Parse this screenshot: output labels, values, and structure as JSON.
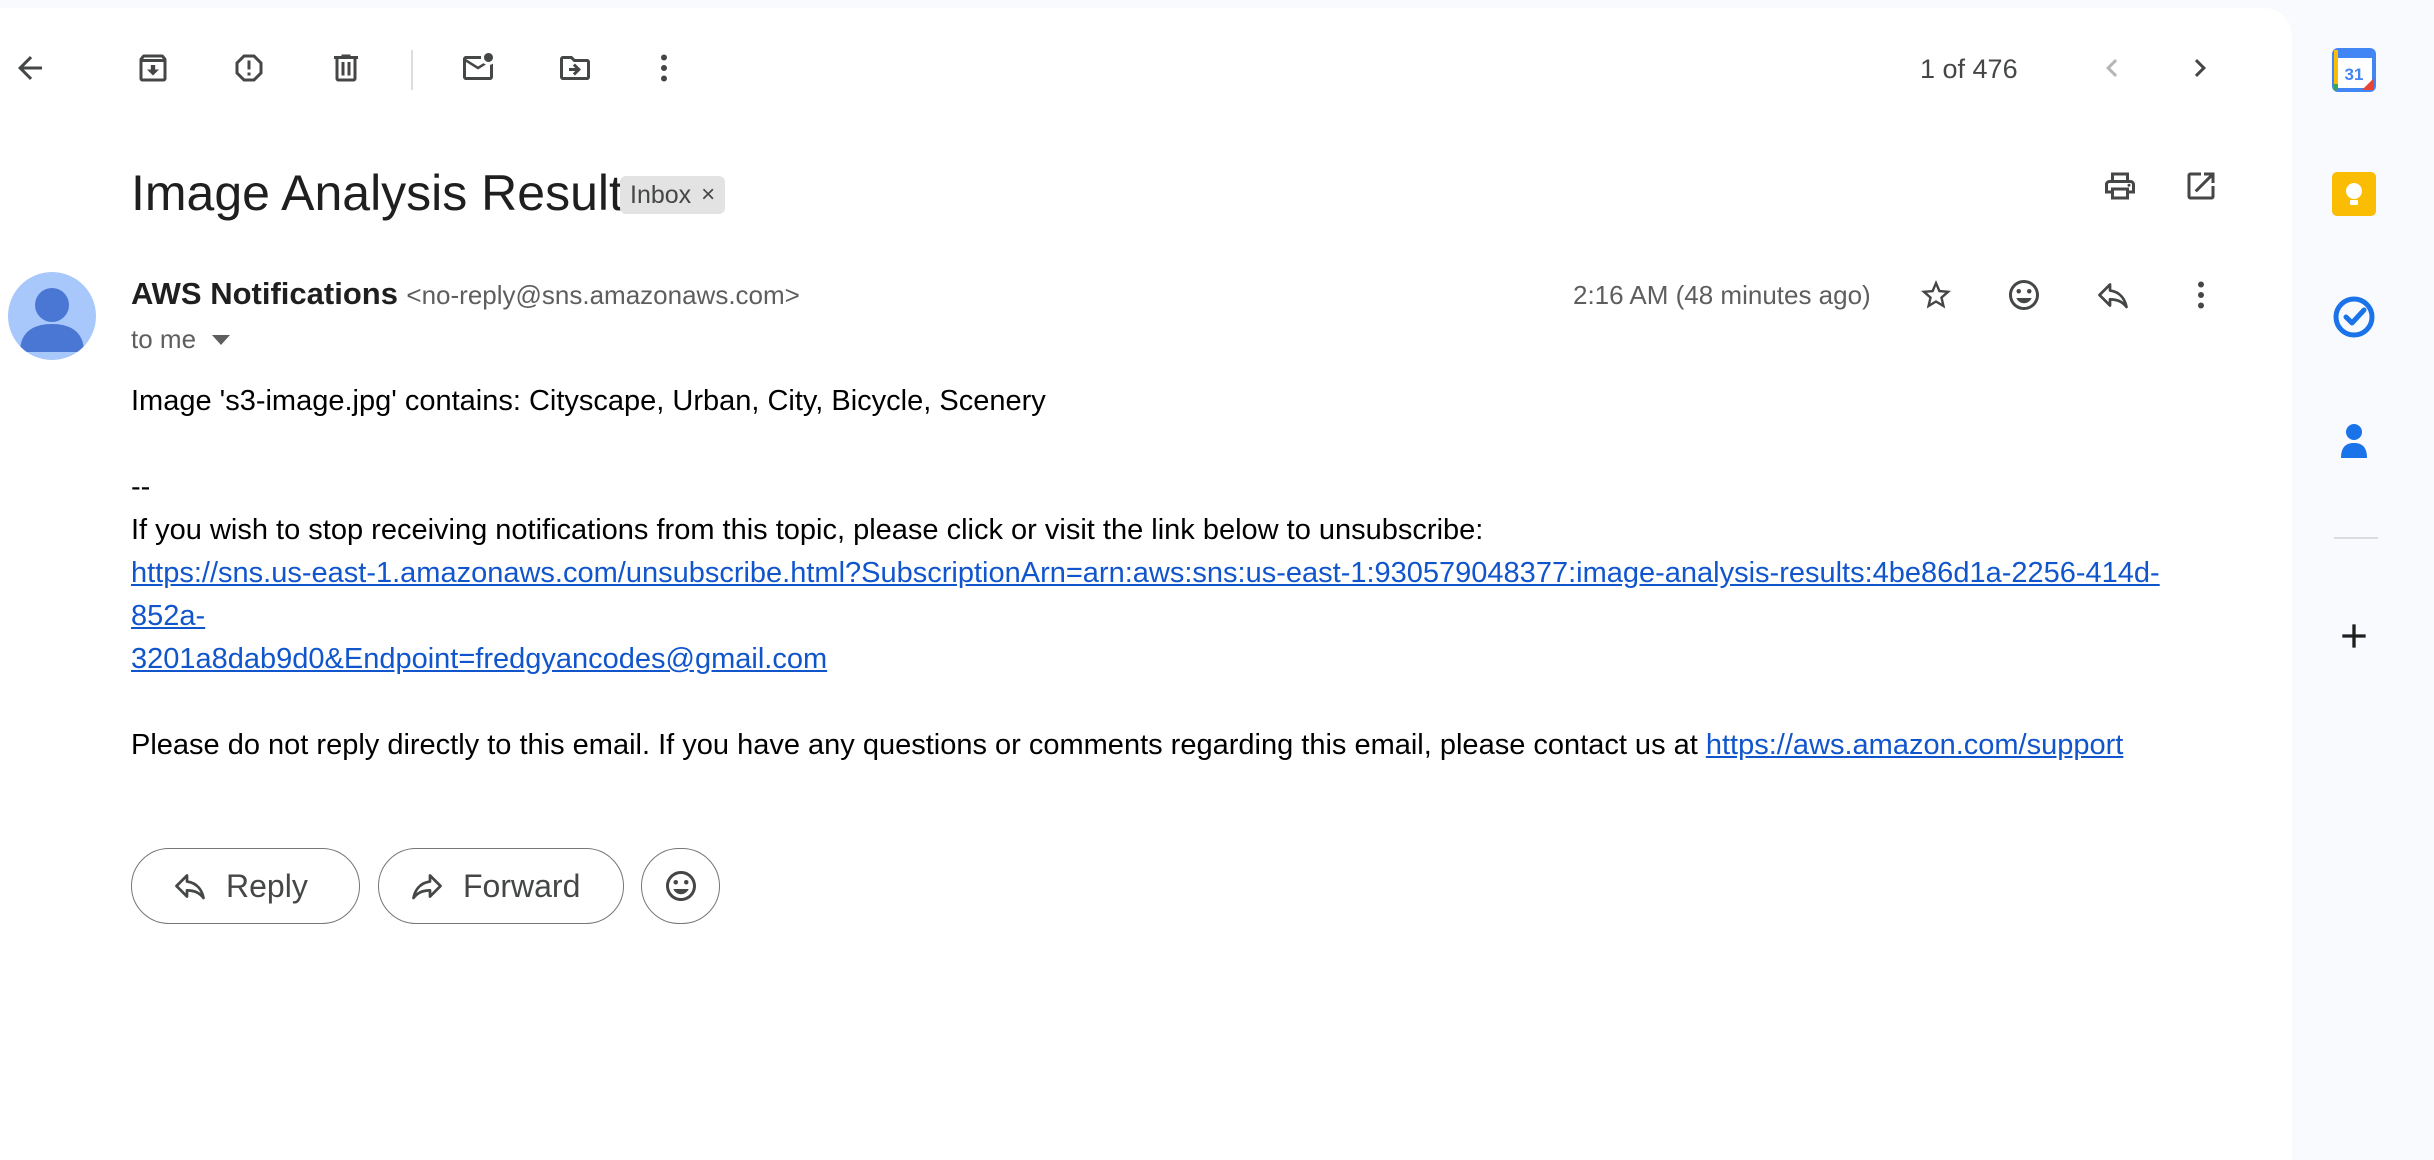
{
  "toolbar": {
    "pager_text": "1 of 476"
  },
  "email": {
    "subject": "Image Analysis Result",
    "label": "Inbox",
    "label_remove": "×",
    "sender_name": "AWS Notifications",
    "sender_email": "<no-reply@sns.amazonaws.com>",
    "recipient": "to me",
    "timestamp": "2:16 AM (48 minutes ago)",
    "body": {
      "line1": "Image 's3-image.jpg' contains: Cityscape, Urban, City, Bicycle, Scenery",
      "signature_sep": "--",
      "unsubscribe_text": "If you wish to stop receiving notifications from this topic, please click or visit the link below to unsubscribe:",
      "unsubscribe_link_line1": "https://sns.us-east-1.amazonaws.com/unsubscribe.html?SubscriptionArn=arn:aws:sns:us-east-1:930579048377:image-analysis-results:4be86d1a-2256-414d-852a-",
      "unsubscribe_link_line2": "3201a8dab9d0&Endpoint=fredgyancodes@gmail.com",
      "contact_text": "Please do not reply directly to this email. If you have any questions or comments regarding this email, please contact us at ",
      "contact_link": "https://aws.amazon.com/support"
    }
  },
  "actions": {
    "reply_label": "Reply",
    "forward_label": "Forward"
  },
  "side_panel": {
    "calendar_day": "31"
  },
  "colors": {
    "link": "#1155cc",
    "calendar_blue": "#4285f4",
    "keep_yellow": "#fbbc04",
    "tasks_blue": "#1a73e8",
    "contacts_blue": "#1a73e8",
    "avatar_bg": "#a8c7fa",
    "avatar_fg": "#4a76d4"
  }
}
